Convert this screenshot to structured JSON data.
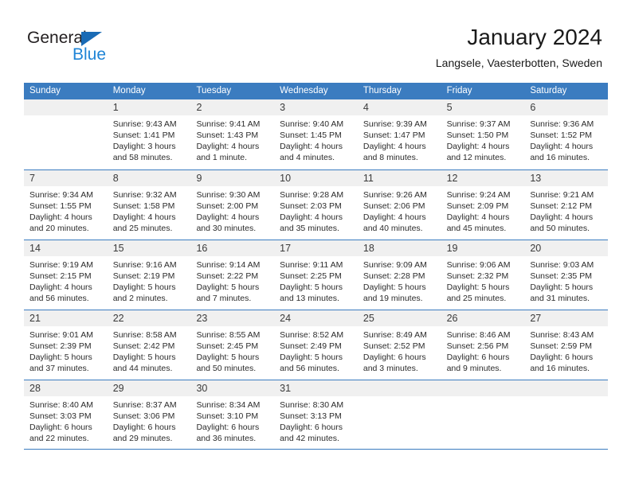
{
  "brand": {
    "name_top": "General",
    "name_bottom": "Blue",
    "accent_color": "#1f84d6",
    "triangle_color": "#1a6bb5"
  },
  "header": {
    "title": "January 2024",
    "subtitle": "Langsele, Vaesterbotten, Sweden"
  },
  "calendar": {
    "header_color": "#3b7cc0",
    "daynum_band_color": "#f0f0f0",
    "weekdays": [
      "Sunday",
      "Monday",
      "Tuesday",
      "Wednesday",
      "Thursday",
      "Friday",
      "Saturday"
    ],
    "weeks": [
      [
        {
          "day": "",
          "sunrise": "",
          "sunset": "",
          "daylight1": "",
          "daylight2": ""
        },
        {
          "day": "1",
          "sunrise": "Sunrise: 9:43 AM",
          "sunset": "Sunset: 1:41 PM",
          "daylight1": "Daylight: 3 hours",
          "daylight2": "and 58 minutes."
        },
        {
          "day": "2",
          "sunrise": "Sunrise: 9:41 AM",
          "sunset": "Sunset: 1:43 PM",
          "daylight1": "Daylight: 4 hours",
          "daylight2": "and 1 minute."
        },
        {
          "day": "3",
          "sunrise": "Sunrise: 9:40 AM",
          "sunset": "Sunset: 1:45 PM",
          "daylight1": "Daylight: 4 hours",
          "daylight2": "and 4 minutes."
        },
        {
          "day": "4",
          "sunrise": "Sunrise: 9:39 AM",
          "sunset": "Sunset: 1:47 PM",
          "daylight1": "Daylight: 4 hours",
          "daylight2": "and 8 minutes."
        },
        {
          "day": "5",
          "sunrise": "Sunrise: 9:37 AM",
          "sunset": "Sunset: 1:50 PM",
          "daylight1": "Daylight: 4 hours",
          "daylight2": "and 12 minutes."
        },
        {
          "day": "6",
          "sunrise": "Sunrise: 9:36 AM",
          "sunset": "Sunset: 1:52 PM",
          "daylight1": "Daylight: 4 hours",
          "daylight2": "and 16 minutes."
        }
      ],
      [
        {
          "day": "7",
          "sunrise": "Sunrise: 9:34 AM",
          "sunset": "Sunset: 1:55 PM",
          "daylight1": "Daylight: 4 hours",
          "daylight2": "and 20 minutes."
        },
        {
          "day": "8",
          "sunrise": "Sunrise: 9:32 AM",
          "sunset": "Sunset: 1:58 PM",
          "daylight1": "Daylight: 4 hours",
          "daylight2": "and 25 minutes."
        },
        {
          "day": "9",
          "sunrise": "Sunrise: 9:30 AM",
          "sunset": "Sunset: 2:00 PM",
          "daylight1": "Daylight: 4 hours",
          "daylight2": "and 30 minutes."
        },
        {
          "day": "10",
          "sunrise": "Sunrise: 9:28 AM",
          "sunset": "Sunset: 2:03 PM",
          "daylight1": "Daylight: 4 hours",
          "daylight2": "and 35 minutes."
        },
        {
          "day": "11",
          "sunrise": "Sunrise: 9:26 AM",
          "sunset": "Sunset: 2:06 PM",
          "daylight1": "Daylight: 4 hours",
          "daylight2": "and 40 minutes."
        },
        {
          "day": "12",
          "sunrise": "Sunrise: 9:24 AM",
          "sunset": "Sunset: 2:09 PM",
          "daylight1": "Daylight: 4 hours",
          "daylight2": "and 45 minutes."
        },
        {
          "day": "13",
          "sunrise": "Sunrise: 9:21 AM",
          "sunset": "Sunset: 2:12 PM",
          "daylight1": "Daylight: 4 hours",
          "daylight2": "and 50 minutes."
        }
      ],
      [
        {
          "day": "14",
          "sunrise": "Sunrise: 9:19 AM",
          "sunset": "Sunset: 2:15 PM",
          "daylight1": "Daylight: 4 hours",
          "daylight2": "and 56 minutes."
        },
        {
          "day": "15",
          "sunrise": "Sunrise: 9:16 AM",
          "sunset": "Sunset: 2:19 PM",
          "daylight1": "Daylight: 5 hours",
          "daylight2": "and 2 minutes."
        },
        {
          "day": "16",
          "sunrise": "Sunrise: 9:14 AM",
          "sunset": "Sunset: 2:22 PM",
          "daylight1": "Daylight: 5 hours",
          "daylight2": "and 7 minutes."
        },
        {
          "day": "17",
          "sunrise": "Sunrise: 9:11 AM",
          "sunset": "Sunset: 2:25 PM",
          "daylight1": "Daylight: 5 hours",
          "daylight2": "and 13 minutes."
        },
        {
          "day": "18",
          "sunrise": "Sunrise: 9:09 AM",
          "sunset": "Sunset: 2:28 PM",
          "daylight1": "Daylight: 5 hours",
          "daylight2": "and 19 minutes."
        },
        {
          "day": "19",
          "sunrise": "Sunrise: 9:06 AM",
          "sunset": "Sunset: 2:32 PM",
          "daylight1": "Daylight: 5 hours",
          "daylight2": "and 25 minutes."
        },
        {
          "day": "20",
          "sunrise": "Sunrise: 9:03 AM",
          "sunset": "Sunset: 2:35 PM",
          "daylight1": "Daylight: 5 hours",
          "daylight2": "and 31 minutes."
        }
      ],
      [
        {
          "day": "21",
          "sunrise": "Sunrise: 9:01 AM",
          "sunset": "Sunset: 2:39 PM",
          "daylight1": "Daylight: 5 hours",
          "daylight2": "and 37 minutes."
        },
        {
          "day": "22",
          "sunrise": "Sunrise: 8:58 AM",
          "sunset": "Sunset: 2:42 PM",
          "daylight1": "Daylight: 5 hours",
          "daylight2": "and 44 minutes."
        },
        {
          "day": "23",
          "sunrise": "Sunrise: 8:55 AM",
          "sunset": "Sunset: 2:45 PM",
          "daylight1": "Daylight: 5 hours",
          "daylight2": "and 50 minutes."
        },
        {
          "day": "24",
          "sunrise": "Sunrise: 8:52 AM",
          "sunset": "Sunset: 2:49 PM",
          "daylight1": "Daylight: 5 hours",
          "daylight2": "and 56 minutes."
        },
        {
          "day": "25",
          "sunrise": "Sunrise: 8:49 AM",
          "sunset": "Sunset: 2:52 PM",
          "daylight1": "Daylight: 6 hours",
          "daylight2": "and 3 minutes."
        },
        {
          "day": "26",
          "sunrise": "Sunrise: 8:46 AM",
          "sunset": "Sunset: 2:56 PM",
          "daylight1": "Daylight: 6 hours",
          "daylight2": "and 9 minutes."
        },
        {
          "day": "27",
          "sunrise": "Sunrise: 8:43 AM",
          "sunset": "Sunset: 2:59 PM",
          "daylight1": "Daylight: 6 hours",
          "daylight2": "and 16 minutes."
        }
      ],
      [
        {
          "day": "28",
          "sunrise": "Sunrise: 8:40 AM",
          "sunset": "Sunset: 3:03 PM",
          "daylight1": "Daylight: 6 hours",
          "daylight2": "and 22 minutes."
        },
        {
          "day": "29",
          "sunrise": "Sunrise: 8:37 AM",
          "sunset": "Sunset: 3:06 PM",
          "daylight1": "Daylight: 6 hours",
          "daylight2": "and 29 minutes."
        },
        {
          "day": "30",
          "sunrise": "Sunrise: 8:34 AM",
          "sunset": "Sunset: 3:10 PM",
          "daylight1": "Daylight: 6 hours",
          "daylight2": "and 36 minutes."
        },
        {
          "day": "31",
          "sunrise": "Sunrise: 8:30 AM",
          "sunset": "Sunset: 3:13 PM",
          "daylight1": "Daylight: 6 hours",
          "daylight2": "and 42 minutes."
        },
        {
          "day": "",
          "sunrise": "",
          "sunset": "",
          "daylight1": "",
          "daylight2": ""
        },
        {
          "day": "",
          "sunrise": "",
          "sunset": "",
          "daylight1": "",
          "daylight2": ""
        },
        {
          "day": "",
          "sunrise": "",
          "sunset": "",
          "daylight1": "",
          "daylight2": ""
        }
      ]
    ]
  }
}
